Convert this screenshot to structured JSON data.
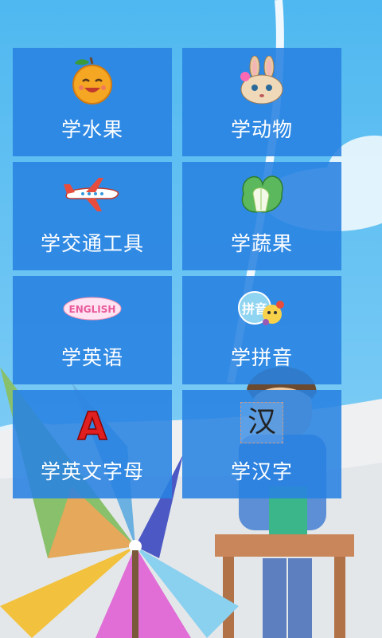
{
  "menu": {
    "items": [
      {
        "label": "学水果",
        "icon": "orange-icon"
      },
      {
        "label": "学动物",
        "icon": "rabbit-icon"
      },
      {
        "label": "学交通工具",
        "icon": "airplane-icon"
      },
      {
        "label": "学蔬果",
        "icon": "cabbage-icon"
      },
      {
        "label": "学英语",
        "icon": "english-icon"
      },
      {
        "label": "学拼音",
        "icon": "pinyin-icon"
      },
      {
        "label": "学英文字母",
        "icon": "letter-a-icon"
      },
      {
        "label": "学汉字",
        "icon": "hanzi-icon"
      }
    ],
    "english_icon_text": "ENGLISH",
    "pinyin_icon_text": "拼音",
    "letter_icon_text": "A",
    "hanzi_icon_text": "汉"
  },
  "colors": {
    "sky": "#5bc0f2",
    "tile": "#2882e1",
    "label": "#ffffff"
  }
}
